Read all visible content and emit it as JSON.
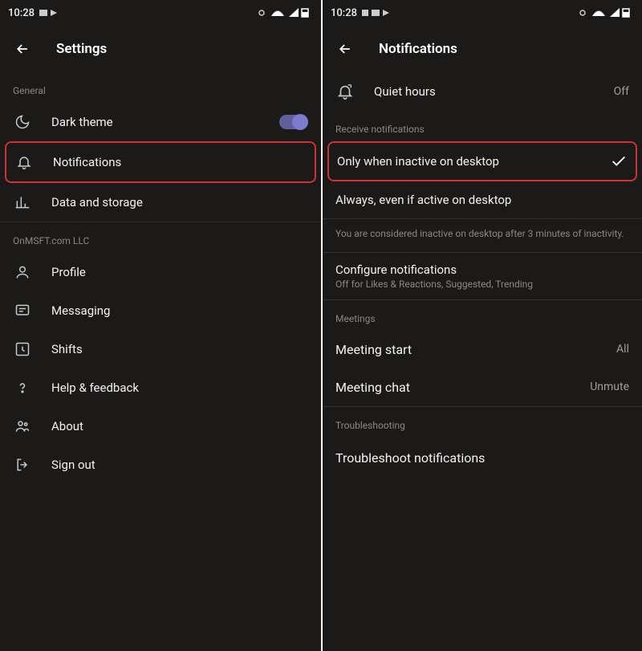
{
  "status": {
    "time": "10:28",
    "icons_left": "✉ ▸",
    "icons_right": "👁"
  },
  "left": {
    "title": "Settings",
    "sections": {
      "general": "General",
      "org": "OnMSFT.com LLC"
    },
    "items": {
      "dark_theme": "Dark theme",
      "notifications": "Notifications",
      "data_storage": "Data and storage",
      "profile": "Profile",
      "messaging": "Messaging",
      "shifts": "Shifts",
      "help": "Help & feedback",
      "about": "About",
      "sign_out": "Sign out"
    }
  },
  "right": {
    "title": "Notifications",
    "quiet_hours": {
      "label": "Quiet hours",
      "value": "Off"
    },
    "receive_section": "Receive notifications",
    "option_inactive": "Only when inactive on desktop",
    "option_always": "Always, even if active on desktop",
    "inactive_note": "You are considered inactive on desktop after 3 minutes of inactivity.",
    "configure": {
      "title": "Configure notifications",
      "sub": "Off for Likes & Reactions, Suggested, Trending"
    },
    "meetings_section": "Meetings",
    "meeting_start": {
      "label": "Meeting start",
      "value": "All"
    },
    "meeting_chat": {
      "label": "Meeting chat",
      "value": "Unmute"
    },
    "troubleshoot_section": "Troubleshooting",
    "troubleshoot": "Troubleshoot notifications"
  }
}
